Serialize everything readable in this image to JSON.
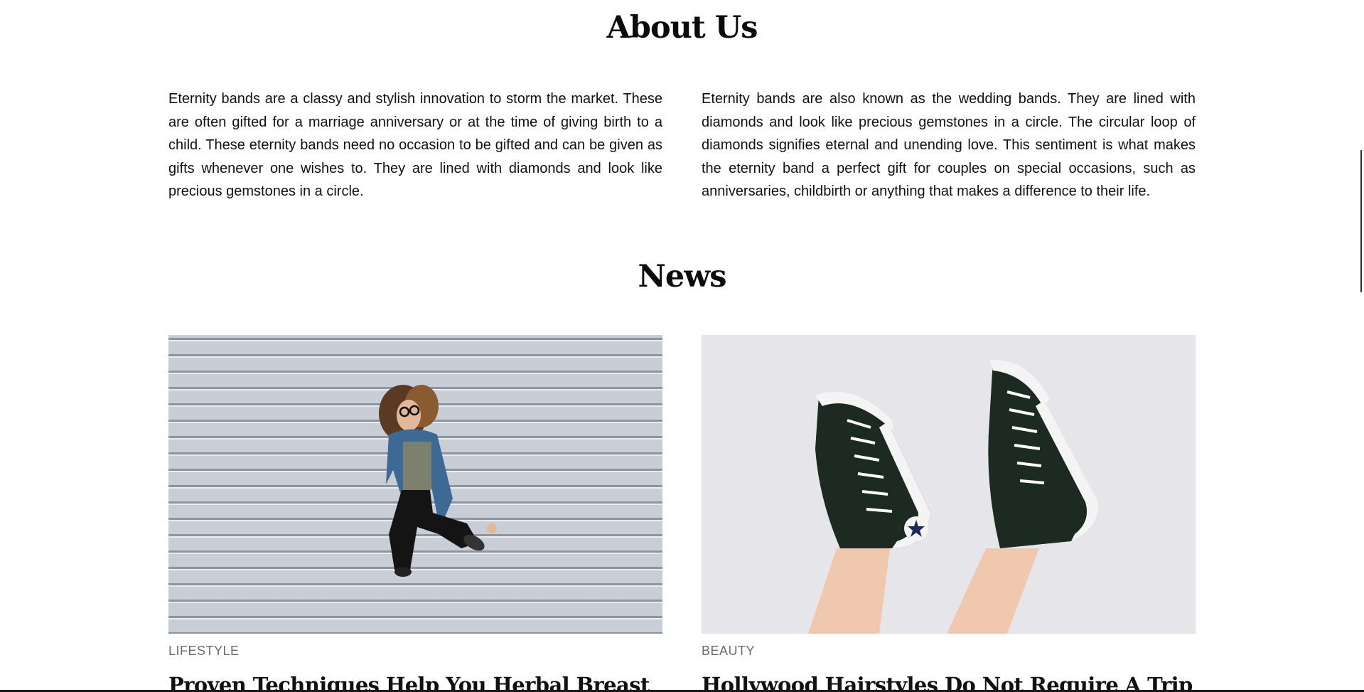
{
  "about": {
    "title": "About Us",
    "left_text": "Eternity bands are a classy and stylish innovation to storm the market. These are often gifted for a marriage anniversary or at the time of giving birth to a child. These eternity bands need no occasion to be gifted and can be given as gifts whenever one wishes to. They are lined with diamonds and look like precious gemstones in a circle.",
    "right_text": "Eternity bands are also known as the wedding bands. They are lined with diamonds and look like precious gemstones in a circle. The circular loop of diamonds signifies eternal and unending love. This sentiment is what makes the eternity band a perfect gift for couples on special occasions, such as anniversaries, childbirth or anything that makes a difference to their life."
  },
  "news": {
    "title": "News",
    "items": [
      {
        "category": "LIFESTYLE",
        "headline": "Proven Techniques Help You Herbal Breast",
        "image": "woman-jumping-photo"
      },
      {
        "category": "BEAUTY",
        "headline": "Hollywood Hairstyles Do Not Require A Trip To A",
        "image": "sneakers-photo"
      }
    ]
  },
  "colors": {
    "background": "#ffffff",
    "text": "#111111",
    "category": "#6b6b6b"
  }
}
